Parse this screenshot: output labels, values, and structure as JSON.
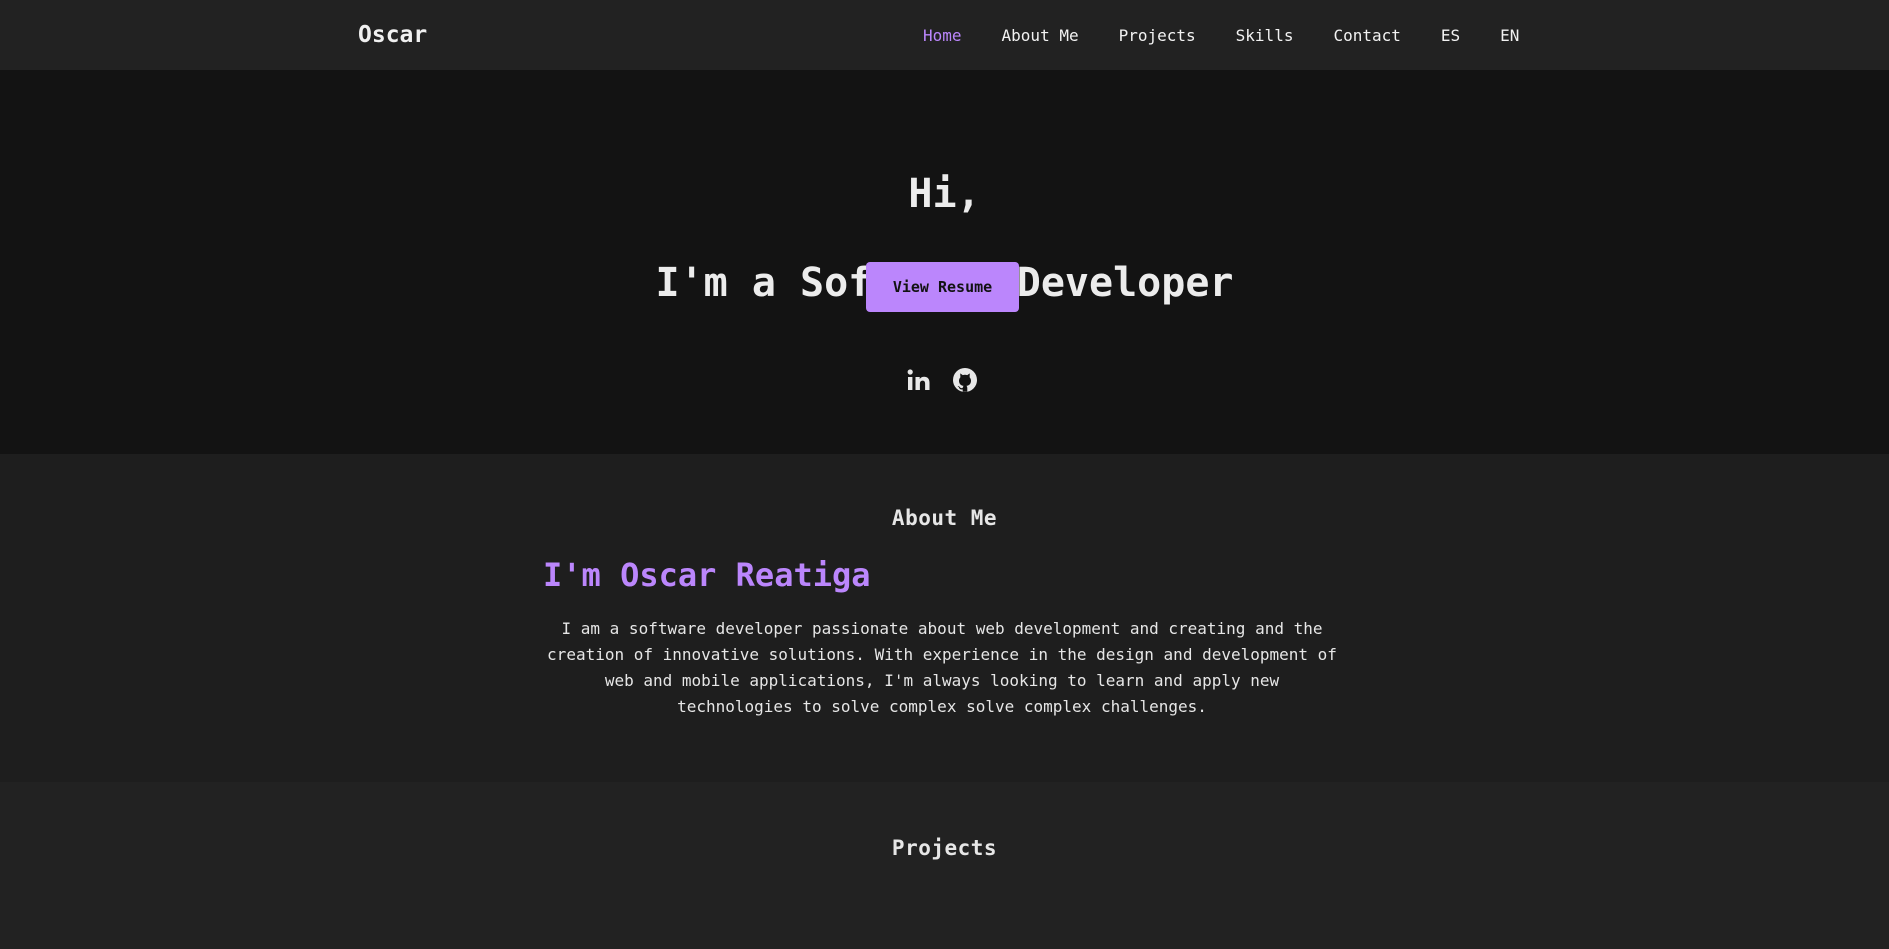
{
  "brand": "Oscar",
  "nav": {
    "items": [
      "Home",
      "About Me",
      "Projects",
      "Skills",
      "Contact",
      "ES",
      "EN"
    ],
    "active": "Home"
  },
  "hero": {
    "greeting": "Hi,",
    "role": "I'm a Software Developer",
    "resume_button": "View Resume",
    "socials": [
      "linkedin-icon",
      "github-icon"
    ]
  },
  "about": {
    "title": "About Me",
    "name": "I'm Oscar Reatiga",
    "text": "I am a software developer passionate about web development and creating and the creation of innovative solutions. With experience in the design and development of web and mobile applications, I'm always looking to learn and apply new technologies to solve complex solve complex challenges."
  },
  "projects": {
    "title": "Projects"
  },
  "colors": {
    "accent": "#bb86fc",
    "header_bg": "#222222",
    "hero_bg": "#131313",
    "section_bg": "#1e1e1e"
  }
}
